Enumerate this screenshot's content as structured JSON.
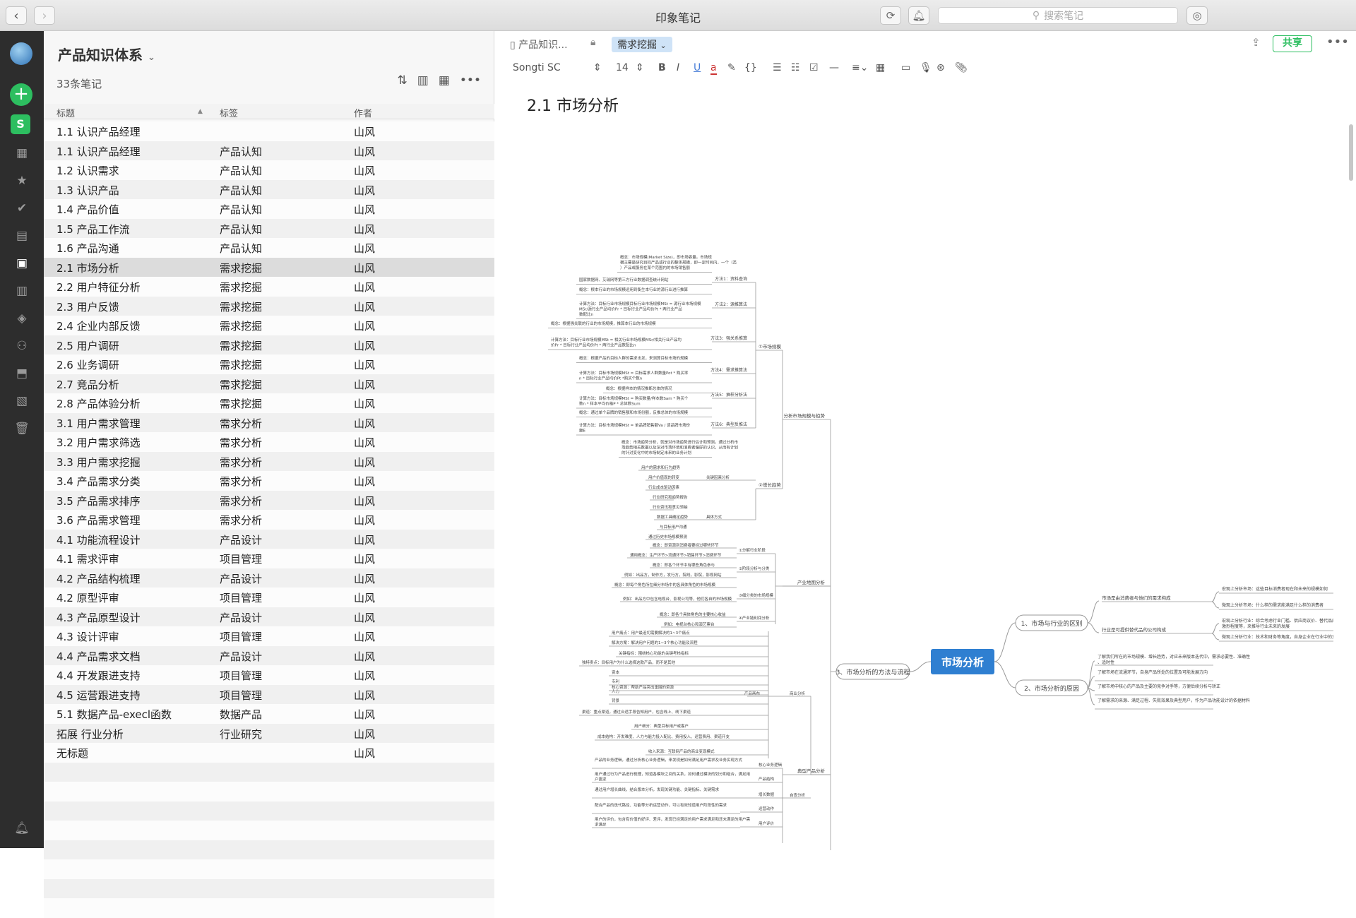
{
  "window": {
    "title": "印象笔记",
    "back": "‹",
    "forward": "›"
  },
  "search": {
    "placeholder": "搜索笔记"
  },
  "notebook": {
    "title": "产品知识体系",
    "count": "33条笔记"
  },
  "columns": {
    "title": "标题",
    "tag": "标签",
    "author": "作者"
  },
  "notes": [
    {
      "title": "1.1  认识产品经理",
      "tag": "",
      "author": "山风"
    },
    {
      "title": "1.1  认识产品经理",
      "tag": "产品认知",
      "author": "山风"
    },
    {
      "title": "1.2  认识需求",
      "tag": "产品认知",
      "author": "山风"
    },
    {
      "title": "1.3  认识产品",
      "tag": "产品认知",
      "author": "山风"
    },
    {
      "title": "1.4  产品价值",
      "tag": "产品认知",
      "author": "山风"
    },
    {
      "title": "1.5  产品工作流",
      "tag": "产品认知",
      "author": "山风"
    },
    {
      "title": "1.6  产品沟通",
      "tag": "产品认知",
      "author": "山风"
    },
    {
      "title": "2.1  市场分析",
      "tag": "需求挖掘",
      "author": "山风"
    },
    {
      "title": "2.2  用户特征分析",
      "tag": "需求挖掘",
      "author": "山风"
    },
    {
      "title": "2.3  用户反馈",
      "tag": "需求挖掘",
      "author": "山风"
    },
    {
      "title": "2.4  企业内部反馈",
      "tag": "需求挖掘",
      "author": "山风"
    },
    {
      "title": "2.5  用户调研",
      "tag": "需求挖掘",
      "author": "山风"
    },
    {
      "title": "2.6  业务调研",
      "tag": "需求挖掘",
      "author": "山风"
    },
    {
      "title": "2.7  竞品分析",
      "tag": "需求挖掘",
      "author": "山风"
    },
    {
      "title": "2.8  产品体验分析",
      "tag": "需求挖掘",
      "author": "山风"
    },
    {
      "title": "3.1  用户需求管理",
      "tag": "需求分析",
      "author": "山风"
    },
    {
      "title": "3.2  用户需求筛选",
      "tag": "需求分析",
      "author": "山风"
    },
    {
      "title": "3.3  用户需求挖掘",
      "tag": "需求分析",
      "author": "山风"
    },
    {
      "title": "3.4  产品需求分类",
      "tag": "需求分析",
      "author": "山风"
    },
    {
      "title": "3.5  产品需求排序",
      "tag": "需求分析",
      "author": "山风"
    },
    {
      "title": "3.6  产品需求管理",
      "tag": "需求分析",
      "author": "山风"
    },
    {
      "title": "4.1   功能流程设计",
      "tag": "产品设计",
      "author": "山风"
    },
    {
      "title": "4.1  需求评审",
      "tag": "项目管理",
      "author": "山风"
    },
    {
      "title": "4.2  产品结构梳理",
      "tag": "产品设计",
      "author": "山风"
    },
    {
      "title": "4.2  原型评审",
      "tag": "项目管理",
      "author": "山风"
    },
    {
      "title": "4.3  产品原型设计",
      "tag": "产品设计",
      "author": "山风"
    },
    {
      "title": "4.3  设计评审",
      "tag": "项目管理",
      "author": "山风"
    },
    {
      "title": "4.4  产品需求文档",
      "tag": "产品设计",
      "author": "山风"
    },
    {
      "title": "4.4  开发跟进支持",
      "tag": "项目管理",
      "author": "山风"
    },
    {
      "title": "4.5  运营跟进支持",
      "tag": "项目管理",
      "author": "山风"
    },
    {
      "title": "5.1  数据产品-execl函数",
      "tag": "数据产品",
      "author": "山风"
    },
    {
      "title": "拓展  行业分析",
      "tag": "行业研究",
      "author": "山风"
    },
    {
      "title": "无标题",
      "tag": "",
      "author": "山风"
    }
  ],
  "editor": {
    "breadcrumb": "产品知识...",
    "tag": "需求挖掘",
    "share": "共享",
    "font": "Songti SC",
    "font_size": "14",
    "title": "2.1  市场分析"
  },
  "mindmap": {
    "root": "市场分析",
    "right": [
      {
        "label": "1、市场与行业的区别",
        "sub": [
          {
            "label": "市场是由消费者与他们的需求构成",
            "notes": [
              "宏观上分析市场：这些目标消费者现在和未来的规模如何",
              "微观上分析市场：什么样的需求能满足什么样的消费者"
            ]
          },
          {
            "label": "行业是可提供替代品的公司构成",
            "notes": [
              "宏观上分析行业：综合考虑行业门槛、供应商议价、替代品威胁、同行业竞争激烈程度等，来推导行业未来的发展",
              "微观上分析行业：技术和财务等角度，自身企业在行业中的竞争力"
            ]
          }
        ]
      },
      {
        "label": "2、市场分析的原因",
        "notes": [
          "了解我们所在的市场规模、增长趋势，对应未来版本迭代中，需求必要性、准确性、适时性",
          "了解市场在流通环节，自身产品所处的位置及可能发展方向",
          "了解市场中核心的产品及主要的竞争对手等，方便后续分析与矫正",
          "了解需求的来源、满足过程、失败效果及典型用户，作为产品功能设计的依据材料"
        ]
      }
    ],
    "left_main": [
      "分析市场规模与趋势",
      "产业地图分析",
      "3、市场分析的方法与流程",
      "典型产品分析"
    ],
    "left_mid": [
      "①市场规模",
      "②增长趋势",
      "①分解行业阶段",
      "②阶段分析与分类",
      "③细分类的市场规模",
      "④产业链利润分析",
      "产品画布",
      "商业分析",
      "自查分析"
    ],
    "methods": [
      "方法1：资料查询",
      "方法2：源推算法",
      "方法3：强关系推算",
      "方法4：需求推算法",
      "方法5：抽样分析法",
      "方法6：典型反推法",
      "关键因素分析",
      "具体方式",
      "核心业务逻辑",
      "产品结构",
      "增长数据",
      "运营动作",
      "用户评价"
    ],
    "texts": [
      "概念：市场规模(Market Size)，即市场容量。市场规模主要是研究目标产品或行业的整体规模，即一定时间内，一个（类）产品或服务在某个范围内的市场销售额",
      "国家数据网、艾瑞网等第三方行业数据调查统计网站",
      "概念：根本行业的市场规模运用到衡生本行业的源行业进行推算",
      "计算方法：目标行业市场规模目标行业市场规模MSt = 源行业市场规模MSr/源行业产品均价Pr * 目标行业产品均价Pt * 两行业产品数配比n",
      "概念：根据强关联的行业的市场规模，推算本行业的市场规模",
      "计算方法：目标行业市场规模MSt = 相关行业市场规模MSr/相关行业产品均价Pr * 目标行业产品均价Pt * 两行业产品数配比n",
      "概念：根据产品的目标人群的需求出发，来测算目标市场的规模",
      "计算方法：目标市场规模MSt = 目标需求人群数量Pot * 购买率n * 目标行业产品均价Pt *购买个数n",
      "概念：根据样本的情况推断总体的情况",
      "计算方法：目标市场规模MSt = 购买数量/样本数Sam * 购买个数n * 样本平均价格P * 总体数Sum",
      "概念：通过单个品牌的销售额和市场份额，反推总体的市场规模",
      "计算方法：目标市场规模MSt = 单品牌销售额Va / 该品牌市场份额E",
      "概念：市场趋势分析，就是对市场趋势进行估计和预测。通过分析市场趋势相关数据以及深对市场环境和消费者偏好的认识，从而有计划的针对变化中的市场制定未来的业务计划",
      "用户的需求和行为趋势",
      "用户价值观的转变",
      "行业成本驱动因素",
      "行业研究和趋势报告",
      "行业资讯和意见领袖",
      "数据工具确定趋势",
      "与目标用户沟通",
      "通过历史市场规模预测",
      "概念：即资源到消费者要经过哪些环节",
      "通用概念：生产环节>流通环节>销售环节>消费环节",
      "概念：即各个环节中有哪些角色参与",
      "例如：出品方，制作方，发行方，院线，影院，影视网站",
      "概念：即每个角色所在细分市场中的各具体角色的市场规模",
      "例如：出品方中包含电视台、影视公司等，他们各自的市场规模",
      "概念：即各个具体角色的主要核心收益",
      "例如：电视台核心和演艺票台",
      "用户痛点：用户最迫切需要解决的1~3个痛点",
      "解决方案：解决用户问题的1~3个核心功能及流程",
      "关键指标：围绕核心功能的关键考核指标",
      "独特卖点：目标用户为什么选择这款产品，而不是其他",
      "资本",
      "专利",
      "人力",
      "背景",
      "核心资源：帮助产品突出重围的资源",
      "渠道：重点渠道，通过合适手段告知用户，包含线上、线下渠道",
      "用户细分：典型目标用户或客户",
      "成本结构：开发难度、人力与能力投入配比、费用投入、运营费用、渠道开支",
      "收入来源：互联网产品的商业变现模式",
      "产品的业务逻辑，通过分析核心业务逻辑，来发现是如何满足用户需求及业务实现方式",
      "用户通过行为产品进行梳理，知道各模块之间的关系，如何通过模块的划分和组合，满足用户需求",
      "通过用户增长曲线，结合版本分析，发现关键功能、关键指标、关键需求",
      "配合产品的迭代路径、功能等分析运营动作，可以有效知道用户阶段性的需求",
      "用户的评价，包含有价值的好评、差评，发现已经满足的用户需求满足和还未满足的用户需求满足"
    ]
  }
}
